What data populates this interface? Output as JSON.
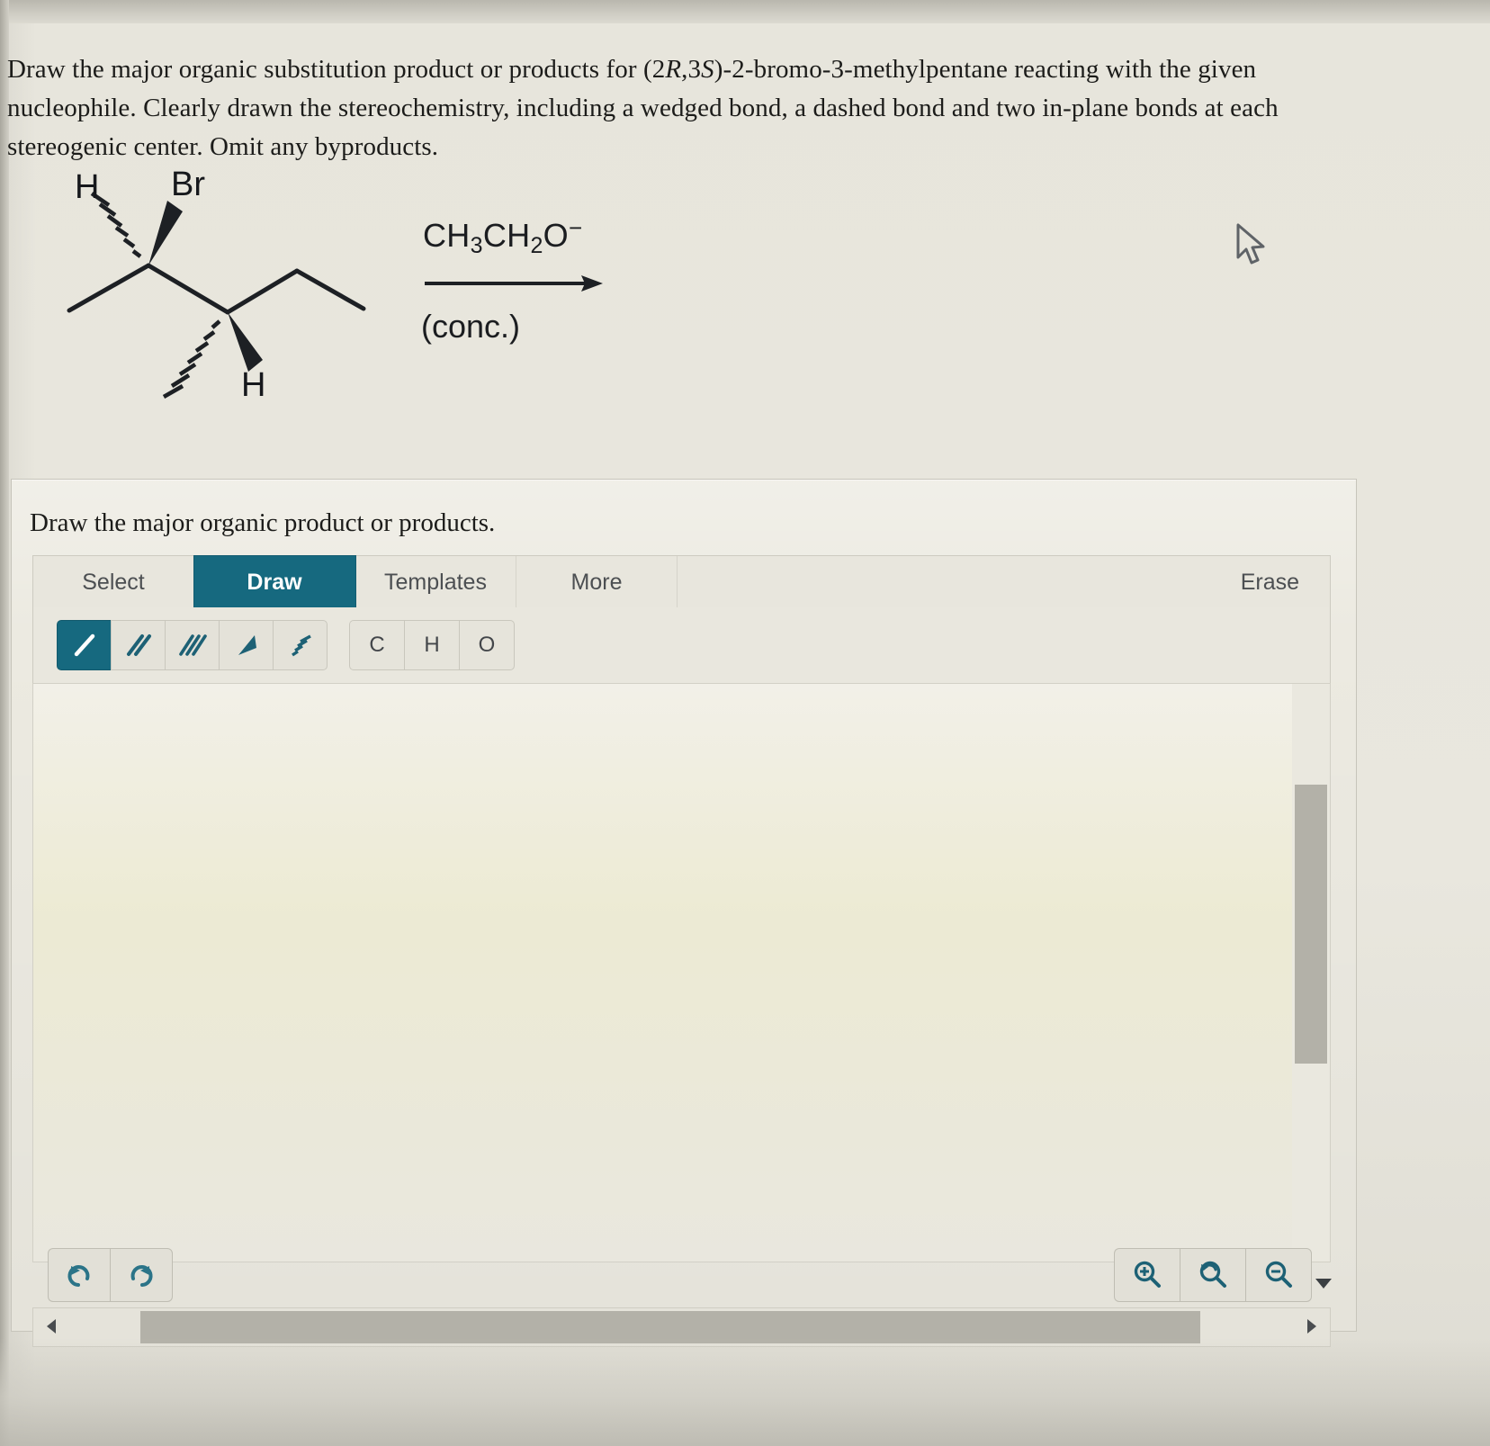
{
  "question": {
    "line1_a": "Draw the major organic substitution product or products for (2",
    "line1_r": "R",
    "line1_b": ",3",
    "line1_s": "S",
    "line1_c": ")-2-bromo-3-methylpentane reacting with the given",
    "line2": "nucleophile. Clearly drawn the stereochemistry, including a wedged bond, a dashed bond and two in-plane bonds at each",
    "line3": "stereogenic center. Omit any byproducts."
  },
  "scheme": {
    "substrate_labels": {
      "h_top": "H",
      "br": "Br",
      "h_bottom": "H"
    },
    "reagent": {
      "part1": "CH",
      "sub1": "3",
      "part2": "CH",
      "sub2": "2",
      "part3": "O",
      "charge": "−"
    },
    "condition": "(conc.)"
  },
  "panel": {
    "prompt": "Draw the major organic product or products.",
    "tabs": [
      {
        "label": "Select",
        "active": false
      },
      {
        "label": "Draw",
        "active": true
      },
      {
        "label": "Templates",
        "active": false
      },
      {
        "label": "More",
        "active": false
      }
    ],
    "erase_label": "Erase",
    "bond_tools": [
      {
        "name": "single-bond-tool",
        "active": true
      },
      {
        "name": "double-bond-tool",
        "active": false
      },
      {
        "name": "triple-bond-tool",
        "active": false
      },
      {
        "name": "wedge-bond-tool",
        "active": false
      },
      {
        "name": "dash-bond-tool",
        "active": false
      }
    ],
    "atom_tools": [
      "C",
      "H",
      "O"
    ],
    "history_tools": [
      "undo-icon",
      "redo-icon"
    ],
    "zoom_tools": [
      "zoom-in-icon",
      "zoom-reset-icon",
      "zoom-out-icon"
    ],
    "canvas_empty": true
  },
  "colors": {
    "accent": "#16697f",
    "paper": "#e9e7de",
    "panel": "#eceae1",
    "text": "#1c1c1a",
    "muted_text": "#4c4f52",
    "scrollbar_thumb": "#b3b1a8",
    "icon": "#1d6175"
  }
}
